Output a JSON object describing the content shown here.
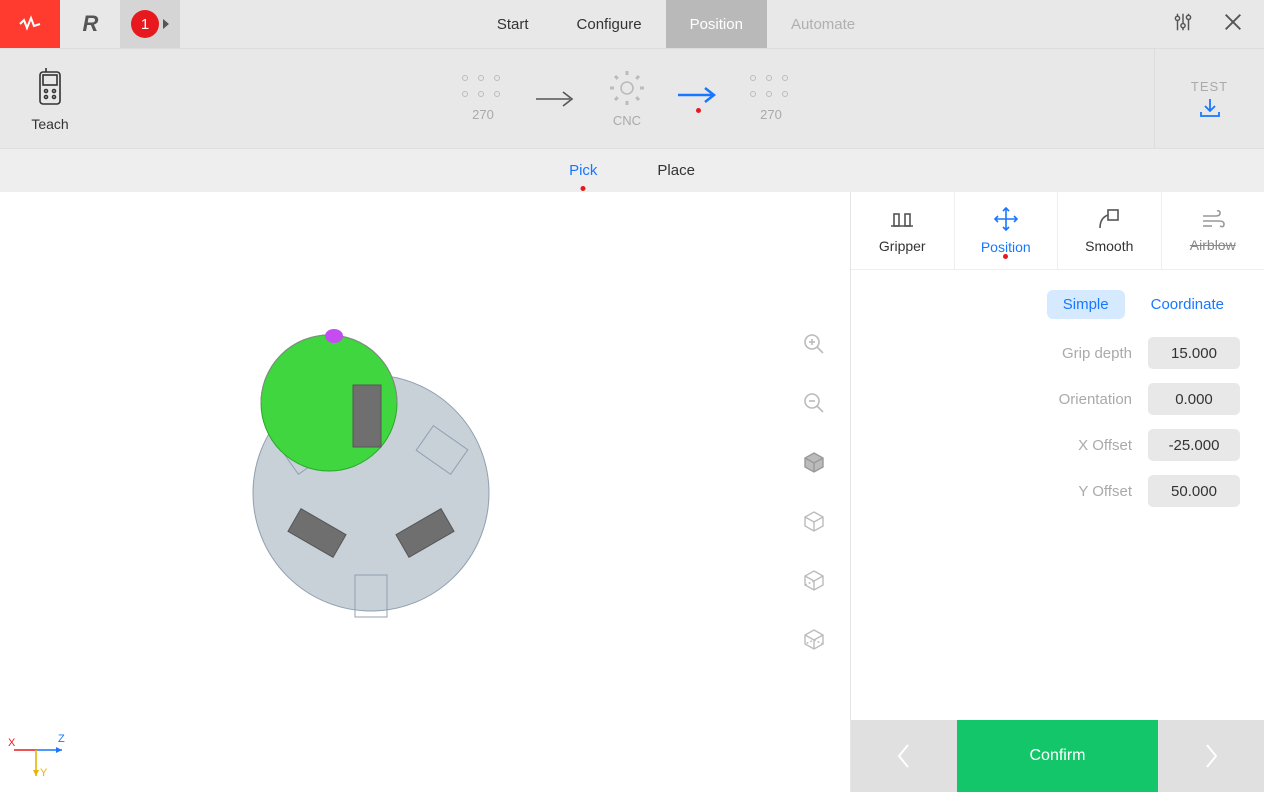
{
  "header": {
    "step_number": "1",
    "logo_char": "R",
    "nav": [
      {
        "id": "start",
        "label": "Start",
        "active": false,
        "disabled": false
      },
      {
        "id": "configure",
        "label": "Configure",
        "active": false,
        "disabled": false
      },
      {
        "id": "position",
        "label": "Position",
        "active": true,
        "disabled": false
      },
      {
        "id": "automate",
        "label": "Automate",
        "active": false,
        "disabled": true
      }
    ]
  },
  "toolbar": {
    "teach_label": "Teach",
    "flow": {
      "from_label": "270",
      "middle_label": "CNC",
      "to_label": "270"
    },
    "test_label": "TEST"
  },
  "subtabs": {
    "pick": "Pick",
    "place": "Place",
    "active": "pick"
  },
  "sidetabs": {
    "gripper": "Gripper",
    "position": "Position",
    "smooth": "Smooth",
    "airblow": "Airblow",
    "active": "position"
  },
  "position_panel": {
    "mode_simple": "Simple",
    "mode_coordinate": "Coordinate",
    "mode_active": "simple",
    "fields": {
      "grip_depth_label": "Grip depth",
      "grip_depth_value": "15.000",
      "orientation_label": "Orientation",
      "orientation_value": "0.000",
      "x_offset_label": "X Offset",
      "x_offset_value": "-25.000",
      "y_offset_label": "Y Offset",
      "y_offset_value": "50.000"
    }
  },
  "footer": {
    "confirm_label": "Confirm"
  },
  "axes": {
    "x": "X",
    "y": "Y",
    "z": "Z"
  },
  "colors": {
    "accent_red": "#e7191f",
    "accent_blue": "#1778ff",
    "accent_green": "#14c66a",
    "part_green": "#33cc33"
  }
}
